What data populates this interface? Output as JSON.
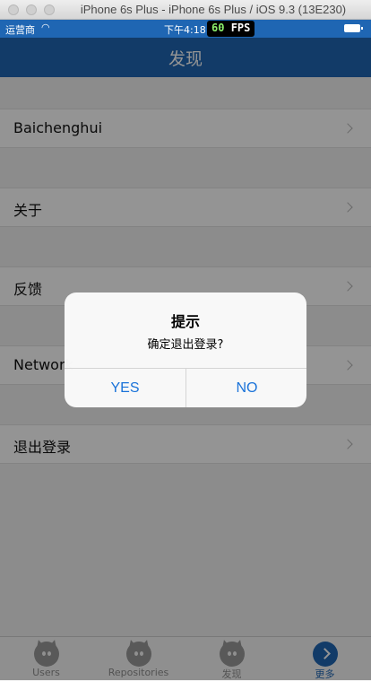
{
  "simulator": {
    "title": "iPhone 6s Plus - iPhone 6s Plus / iOS 9.3 (13E230)"
  },
  "status_bar": {
    "carrier": "运营商",
    "wifi_icon": "wifi-icon",
    "time": "下午4:18",
    "fps_value": "60",
    "fps_unit": "FPS"
  },
  "nav": {
    "title": "发现"
  },
  "rows": [
    {
      "label": "Baichenghui"
    },
    {
      "label": "关于"
    },
    {
      "label": "反馈"
    },
    {
      "label": "Network"
    },
    {
      "label": "退出登录"
    }
  ],
  "tabs": [
    {
      "label": "Users",
      "icon": "github-octocat-icon"
    },
    {
      "label": "Repositories",
      "icon": "github-octocat-icon"
    },
    {
      "label": "发现",
      "icon": "github-octocat-icon"
    },
    {
      "label": "更多",
      "icon": "more-chevron-icon",
      "active": true
    }
  ],
  "alert": {
    "title": "提示",
    "message": "确定退出登录?",
    "yes_label": "YES",
    "no_label": "NO"
  },
  "colors": {
    "nav": "#1f66b3",
    "accent": "#1a73d9"
  }
}
